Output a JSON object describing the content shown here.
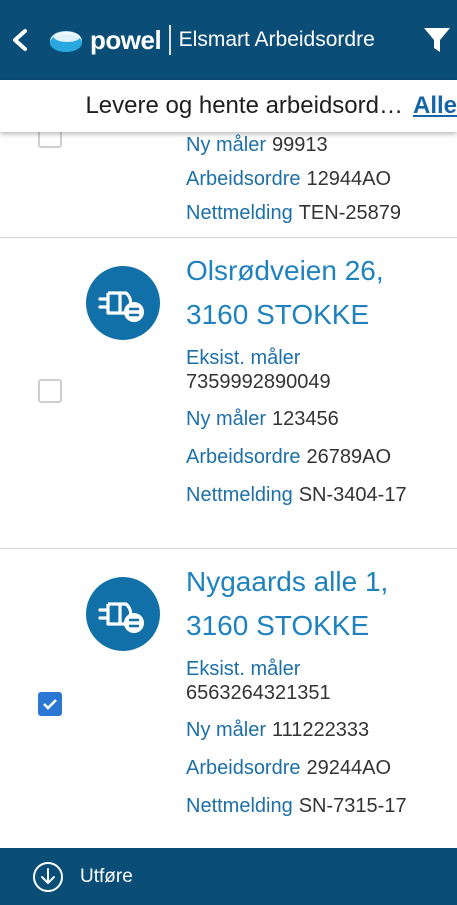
{
  "header": {
    "brand": "powel",
    "app_title": "Elsmart Arbeidsordre",
    "back_icon": "chevron-left-icon",
    "filter_icon": "filter-funnel-icon"
  },
  "subheader": {
    "title": "Levere og hente arbeidsord…",
    "all_link": "Alle"
  },
  "orders": [
    {
      "address_line1": "",
      "address_line2": "",
      "existing_meter_label": "",
      "existing_meter_value": "",
      "new_meter_label": "Ny måler",
      "new_meter_value": "99913",
      "work_order_label": "Arbeidsordre",
      "work_order_value": "12944AO",
      "net_message_label": "Nettmelding",
      "net_message_value": "TEN-25879",
      "checked": false
    },
    {
      "address_line1": "Olsrødveien 26,",
      "address_line2": "3160 STOKKE",
      "existing_meter_label": "Eksist. måler",
      "existing_meter_value": "7359992890049",
      "new_meter_label": "Ny måler",
      "new_meter_value": "123456",
      "work_order_label": "Arbeidsordre",
      "work_order_value": "26789AO",
      "net_message_label": "Nettmelding",
      "net_message_value": "SN-3404-17",
      "checked": false
    },
    {
      "address_line1": "Nygaards alle 1,",
      "address_line2": "3160 STOKKE",
      "existing_meter_label": "Eksist. måler",
      "existing_meter_value": "6563264321351",
      "new_meter_label": "Ny måler",
      "new_meter_value": "111222333",
      "work_order_label": "Arbeidsordre",
      "work_order_value": "29244AO",
      "net_message_label": "Nettmelding",
      "net_message_value": "SN-7315-17",
      "checked": true
    }
  ],
  "footer": {
    "action_label": "Utføre",
    "action_icon": "arrow-down-circle-icon"
  },
  "colors": {
    "primary": "#0a4d76",
    "link": "#1f82bf",
    "checkbox": "#2a78d4"
  }
}
